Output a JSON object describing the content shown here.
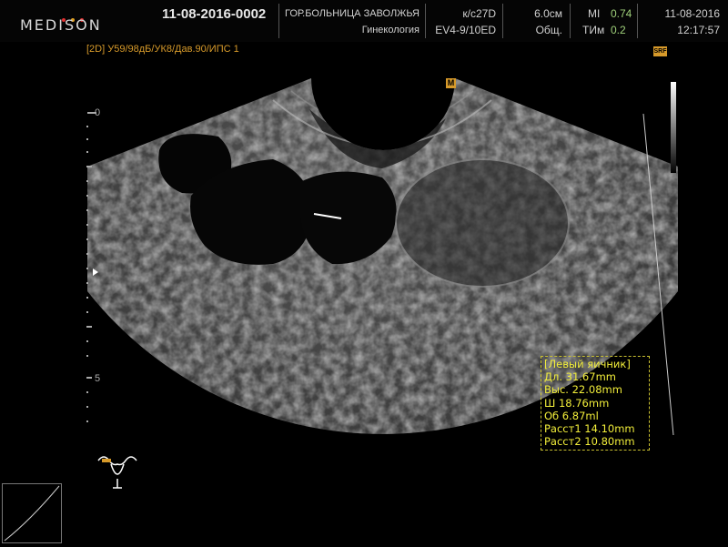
{
  "header": {
    "logo": "MEDISON",
    "patient_id": "11-08-2016-0002",
    "hospital": "ГОР.БОЛЬНИЦА ЗАВОЛЖЬЯ",
    "department": "Гинекология",
    "preset": "к/с27D",
    "probe": "EV4-9/10ED",
    "depth": "6.0cм",
    "app": "Общ.",
    "mi_label": "MI",
    "mi_value": "0.74",
    "tim_label": "ТИм",
    "tim_value": "0.2",
    "date": "11-08-2016",
    "time": "12:17:57"
  },
  "imaging": {
    "mode": "[2D]",
    "params": "У59/98дБ/УК8/Дав.90/ИПС 1",
    "marker": "M",
    "srf": "SRF"
  },
  "depth_scale": {
    "labels": [
      "0",
      "5"
    ]
  },
  "measurements": {
    "title": "[Левый яичник]",
    "items": [
      "Дл. 31.67mm",
      "Выс. 22.08mm",
      "Ш   18.76mm",
      "Об  6.87ml",
      "Расст1 14.10mm",
      "Расст2 10.80mm"
    ]
  },
  "colors": {
    "accent": "#d79a2a",
    "measure": "#f2ee3a"
  }
}
